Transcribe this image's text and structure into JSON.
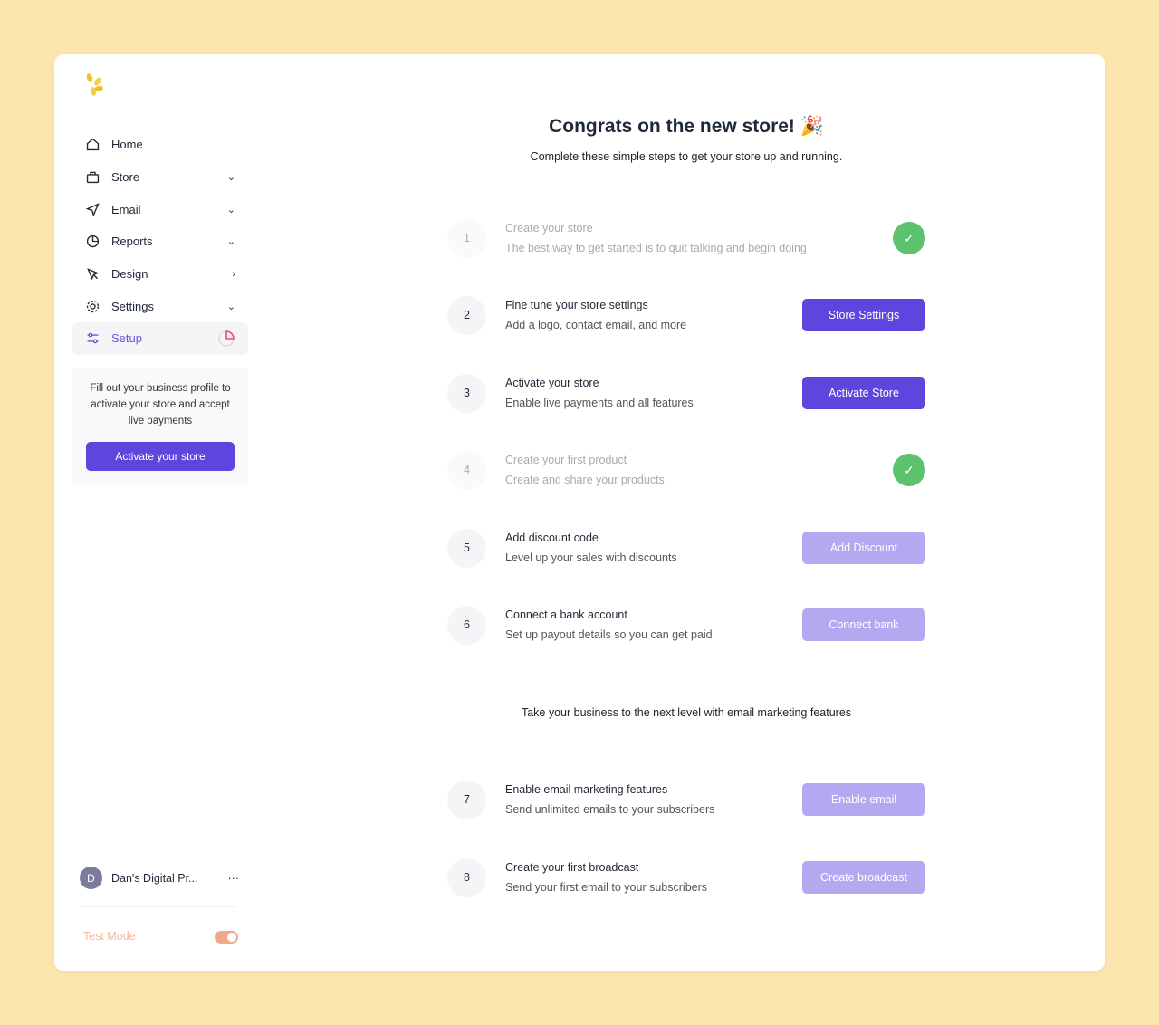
{
  "sidebar": {
    "items": [
      {
        "label": "Home",
        "icon": "home-icon",
        "chevron": ""
      },
      {
        "label": "Store",
        "icon": "bag-icon",
        "chevron": "⌄"
      },
      {
        "label": "Email",
        "icon": "send-icon",
        "chevron": "⌄"
      },
      {
        "label": "Reports",
        "icon": "pie-chart-icon",
        "chevron": "⌄"
      },
      {
        "label": "Design",
        "icon": "cursor-icon",
        "chevron": "›"
      },
      {
        "label": "Settings",
        "icon": "gear-icon",
        "chevron": "⌄"
      },
      {
        "label": "Setup",
        "icon": "sliders-icon",
        "chevron": ""
      }
    ],
    "promo": {
      "text": "Fill out your business profile to activate your store and accept live payments",
      "button": "Activate your store"
    },
    "account": {
      "initial": "D",
      "name": "Dan's Digital Pr...",
      "more": "···"
    },
    "test_mode": {
      "label": "Test Mode",
      "on": true
    }
  },
  "main": {
    "title": "Congrats on the new store! 🎉",
    "subtitle": "Complete these simple steps to get your store up and running.",
    "steps": [
      {
        "num": "1",
        "title": "Create your store",
        "desc": "The best way to get started is to quit talking and begin doing",
        "done": true,
        "check": "✓"
      },
      {
        "num": "2",
        "title": "Fine tune your store settings",
        "desc": "Add a logo, contact email, and more",
        "button": "Store Settings"
      },
      {
        "num": "3",
        "title": "Activate your store",
        "desc": "Enable live payments and all features",
        "button": "Activate Store"
      },
      {
        "num": "4",
        "title": "Create your first product",
        "desc": "Create and share your products",
        "done": true,
        "check": "✓"
      },
      {
        "num": "5",
        "title": "Add discount code",
        "desc": "Level up your sales with discounts",
        "button": "Add Discount"
      },
      {
        "num": "6",
        "title": "Connect a bank account",
        "desc": "Set up payout details so you can get paid",
        "button": "Connect bank"
      },
      {
        "num": "7",
        "title": "Enable email marketing features",
        "desc": "Send unlimited emails to your subscribers",
        "button": "Enable email"
      },
      {
        "num": "8",
        "title": "Create your first broadcast",
        "desc": "Send your first email to your subscribers",
        "button": "Create broadcast"
      }
    ],
    "email_section": "Take your business to the next level with email marketing features"
  },
  "colors": {
    "background": "#fde6ae",
    "accent": "#5e45dd",
    "accent_muted": "#b5a8f0",
    "success": "#5cc36c"
  }
}
